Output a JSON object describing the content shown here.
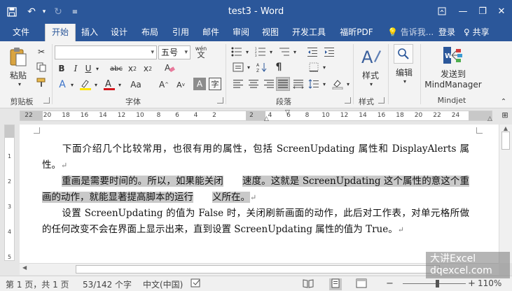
{
  "window": {
    "title": "test3 - Word",
    "quick_access": {
      "save_icon": "save-icon",
      "undo_icon": "undo-icon",
      "redo_icon": "redo-icon",
      "customize_icon": "customize-icon"
    },
    "controls": {
      "ribbon_options_icon": "ribbon-display-icon",
      "minimize": "—",
      "restore": "❐",
      "close": "✕"
    }
  },
  "tabs": [
    {
      "label": "文件"
    },
    {
      "label": "开始"
    },
    {
      "label": "插入"
    },
    {
      "label": "设计"
    },
    {
      "label": "布局"
    },
    {
      "label": "引用"
    },
    {
      "label": "邮件"
    },
    {
      "label": "审阅"
    },
    {
      "label": "视图"
    },
    {
      "label": "开发工具"
    },
    {
      "label": "福昕PDF"
    }
  ],
  "active_tab": "开始",
  "tell_me": "告诉我...",
  "login": "登录",
  "share": "共享",
  "ribbon": {
    "clipboard": {
      "paste_label": "粘贴",
      "group_label": "剪贴板"
    },
    "font": {
      "font_name": "",
      "font_size": "五号",
      "group_label": "字体",
      "wen_label": "wén"
    },
    "paragraph": {
      "group_label": "段落"
    },
    "styles": {
      "styles_label": "样式",
      "group_label": "样式"
    },
    "editing": {
      "editing_label": "编辑"
    },
    "mindjet": {
      "line1": "发送到",
      "line2": "MindManager",
      "group_label": "Mindjet"
    }
  },
  "ruler": {
    "numbers": [
      "22",
      "20",
      "18",
      "16",
      "14",
      "12",
      "10",
      "8",
      "6",
      "4",
      "2",
      "",
      "2",
      "4",
      "6",
      "8",
      "10",
      "12",
      "14",
      "16",
      "18",
      "20",
      "22",
      "24"
    ],
    "vertical_numbers": [
      "1",
      "2",
      "3",
      "4",
      "5"
    ]
  },
  "document": {
    "paragraphs": [
      {
        "text": "下面介绍几个比较常用，也很有用的属性，包括 ScreenUpdating 属性和 DisplayAlerts 属性。"
      },
      {
        "hl1": "重画是需要时间的。所以，如果能关闭",
        "gap": "　　",
        "hl2": "速度。这就是 ScreenUpdating 这个属性的意这个重画的动作，就能显著提高脚本的运行",
        "gap2": "　　",
        "hl3": "义所在。"
      },
      {
        "text": "设置 ScreenUpdating 的值为 False 时，关闭刷新画面的动作，此后对工作表，对单元格所做的任何改变不会在界面上显示出来，直到设置 ScreenUpdating 属性的值为 True。"
      }
    ],
    "para_mark": "↵"
  },
  "status": {
    "page": "第 1 页，共 1 页",
    "words": "53/142 个字",
    "language": "中文(中国)",
    "zoom": "110%"
  },
  "watermark": {
    "line1": "大讲Excel",
    "line2": "dqexcel.com"
  }
}
